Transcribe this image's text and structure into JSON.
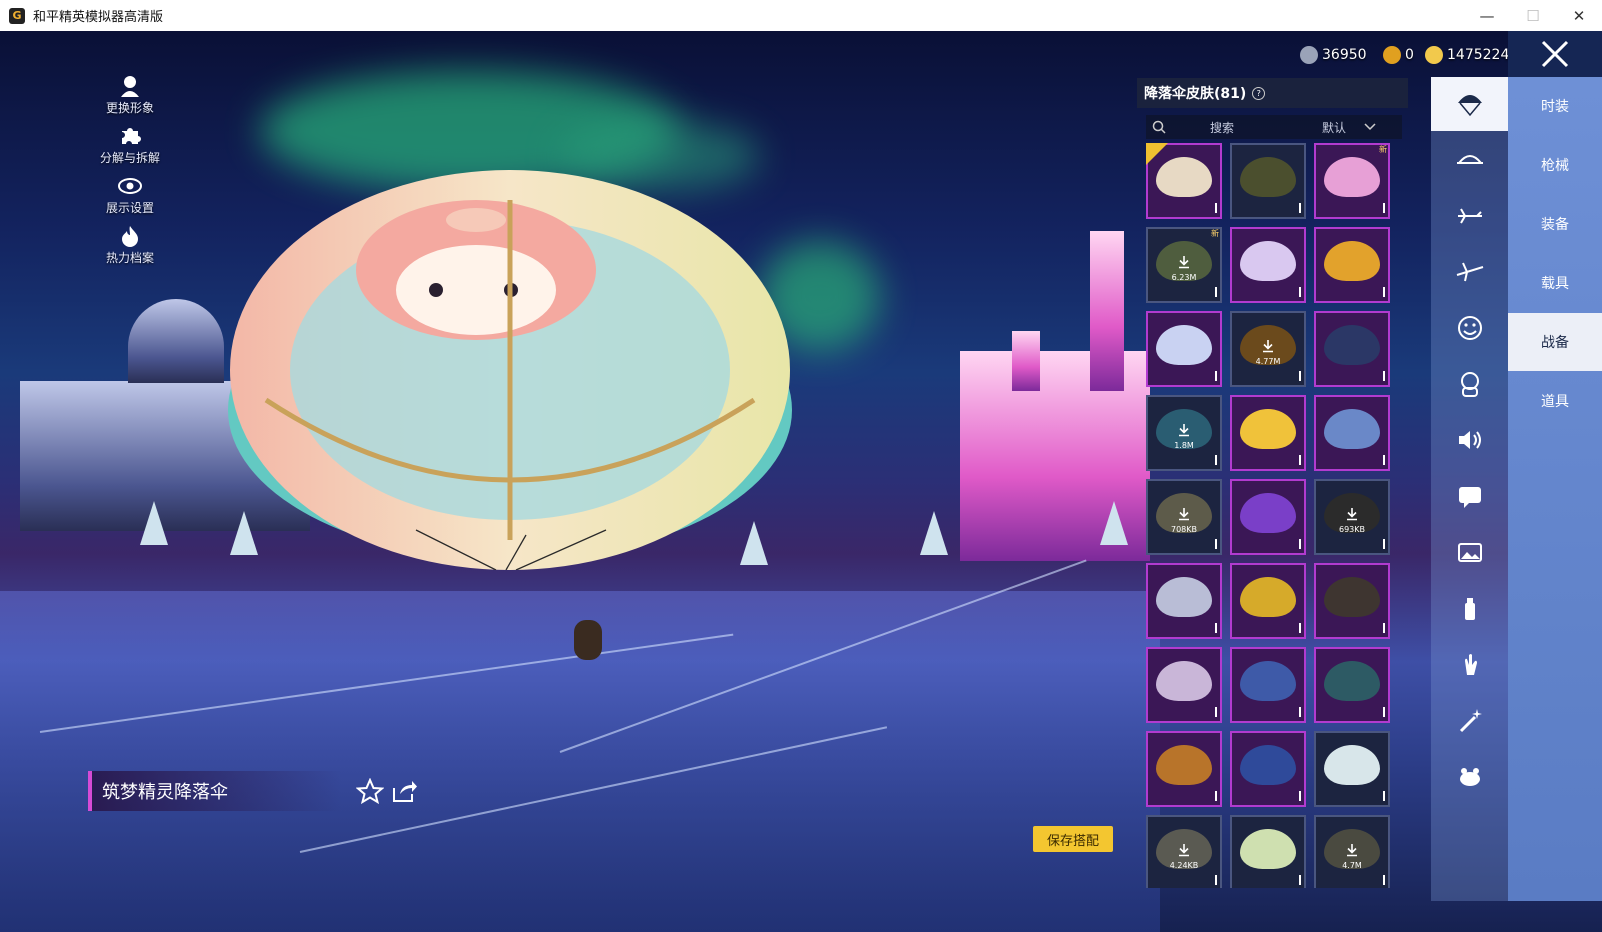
{
  "window": {
    "title": "和平精英模拟器高清版",
    "controls": {
      "minimize": "—",
      "maximize": "☐",
      "close": "✕"
    }
  },
  "currency": [
    {
      "name": "currency-a",
      "value": "36950",
      "color": "#9aa3b8"
    },
    {
      "name": "currency-b",
      "value": "0",
      "color": "#e0a020"
    },
    {
      "name": "currency-c",
      "value": "1475224",
      "color": "#f2c94c"
    }
  ],
  "left_menu": [
    {
      "label": "更换形象",
      "icon": "avatar-icon"
    },
    {
      "label": "分解与拆解",
      "icon": "puzzle-icon"
    },
    {
      "label": "展示设置",
      "icon": "eye-icon"
    },
    {
      "label": "热力档案",
      "icon": "flame-icon"
    }
  ],
  "item": {
    "name": "筑梦精灵降落伞"
  },
  "save_button": "保存搭配",
  "panel": {
    "title": "降落伞皮肤(81)",
    "search_placeholder": "搜索",
    "sort_value": "默认"
  },
  "grid": [
    {
      "sizeLabel": "",
      "isNew": false,
      "selected": true,
      "color": "#e7d9c4",
      "dark": false
    },
    {
      "sizeLabel": "",
      "isNew": false,
      "selected": false,
      "color": "#4b4f2e",
      "dark": true
    },
    {
      "sizeLabel": "",
      "isNew": true,
      "selected": false,
      "color": "#e7a0d6",
      "dark": false
    },
    {
      "sizeLabel": "6.23M",
      "isNew": true,
      "selected": false,
      "color": "#4f5d3e",
      "dark": true
    },
    {
      "sizeLabel": "",
      "isNew": false,
      "selected": false,
      "color": "#d9c8f0",
      "dark": false
    },
    {
      "sizeLabel": "",
      "isNew": false,
      "selected": false,
      "color": "#e2a22c",
      "dark": false
    },
    {
      "sizeLabel": "",
      "isNew": false,
      "selected": false,
      "color": "#c9d2f2",
      "dark": false
    },
    {
      "sizeLabel": "4.77M",
      "isNew": false,
      "selected": false,
      "color": "#6b4a1c",
      "dark": true
    },
    {
      "sizeLabel": "",
      "isNew": false,
      "selected": false,
      "color": "#2b3766",
      "dark": false
    },
    {
      "sizeLabel": "1.8M",
      "isNew": false,
      "selected": false,
      "color": "#2a5d72",
      "dark": true
    },
    {
      "sizeLabel": "",
      "isNew": false,
      "selected": false,
      "color": "#f0c23a",
      "dark": false
    },
    {
      "sizeLabel": "",
      "isNew": false,
      "selected": false,
      "color": "#6a88c8",
      "dark": false
    },
    {
      "sizeLabel": "708KB",
      "isNew": false,
      "selected": false,
      "color": "#5d5b4a",
      "dark": true
    },
    {
      "sizeLabel": "",
      "isNew": false,
      "selected": false,
      "color": "#7a3fc8",
      "dark": false
    },
    {
      "sizeLabel": "693KB",
      "isNew": false,
      "selected": false,
      "color": "#2b2b2b",
      "dark": true
    },
    {
      "sizeLabel": "",
      "isNew": false,
      "selected": false,
      "color": "#b9bdd6",
      "dark": false
    },
    {
      "sizeLabel": "",
      "isNew": false,
      "selected": false,
      "color": "#d6aa2a",
      "dark": false
    },
    {
      "sizeLabel": "",
      "isNew": false,
      "selected": false,
      "color": "#3e3530",
      "dark": false
    },
    {
      "sizeLabel": "",
      "isNew": false,
      "selected": false,
      "color": "#c9b6d8",
      "dark": false
    },
    {
      "sizeLabel": "",
      "isNew": false,
      "selected": false,
      "color": "#3e5aa8",
      "dark": false
    },
    {
      "sizeLabel": "",
      "isNew": false,
      "selected": false,
      "color": "#2d5a64",
      "dark": false
    },
    {
      "sizeLabel": "",
      "isNew": false,
      "selected": false,
      "color": "#b8742a",
      "dark": false
    },
    {
      "sizeLabel": "",
      "isNew": false,
      "selected": false,
      "color": "#2f4a9a",
      "dark": false
    },
    {
      "sizeLabel": "",
      "isNew": false,
      "selected": false,
      "color": "#d8e6ea",
      "dark": true
    },
    {
      "sizeLabel": "4.24KB",
      "isNew": false,
      "selected": false,
      "color": "#5a5a52",
      "dark": true
    },
    {
      "sizeLabel": "",
      "isNew": false,
      "selected": false,
      "color": "#cfe0b0",
      "dark": true
    },
    {
      "sizeLabel": "4.7M",
      "isNew": false,
      "selected": false,
      "color": "#4a4a40",
      "dark": true
    }
  ],
  "categories": [
    "parachute-icon",
    "hat-icon",
    "plane-icon",
    "jet-icon",
    "emote-icon",
    "mascot-icon",
    "voice-icon",
    "message-icon",
    "gallery-icon",
    "spray-icon",
    "gesture-icon",
    "wand-icon",
    "pet-icon"
  ],
  "tabs": [
    "时装",
    "枪械",
    "装备",
    "载具",
    "战备",
    "道具"
  ],
  "active_tab": "战备"
}
